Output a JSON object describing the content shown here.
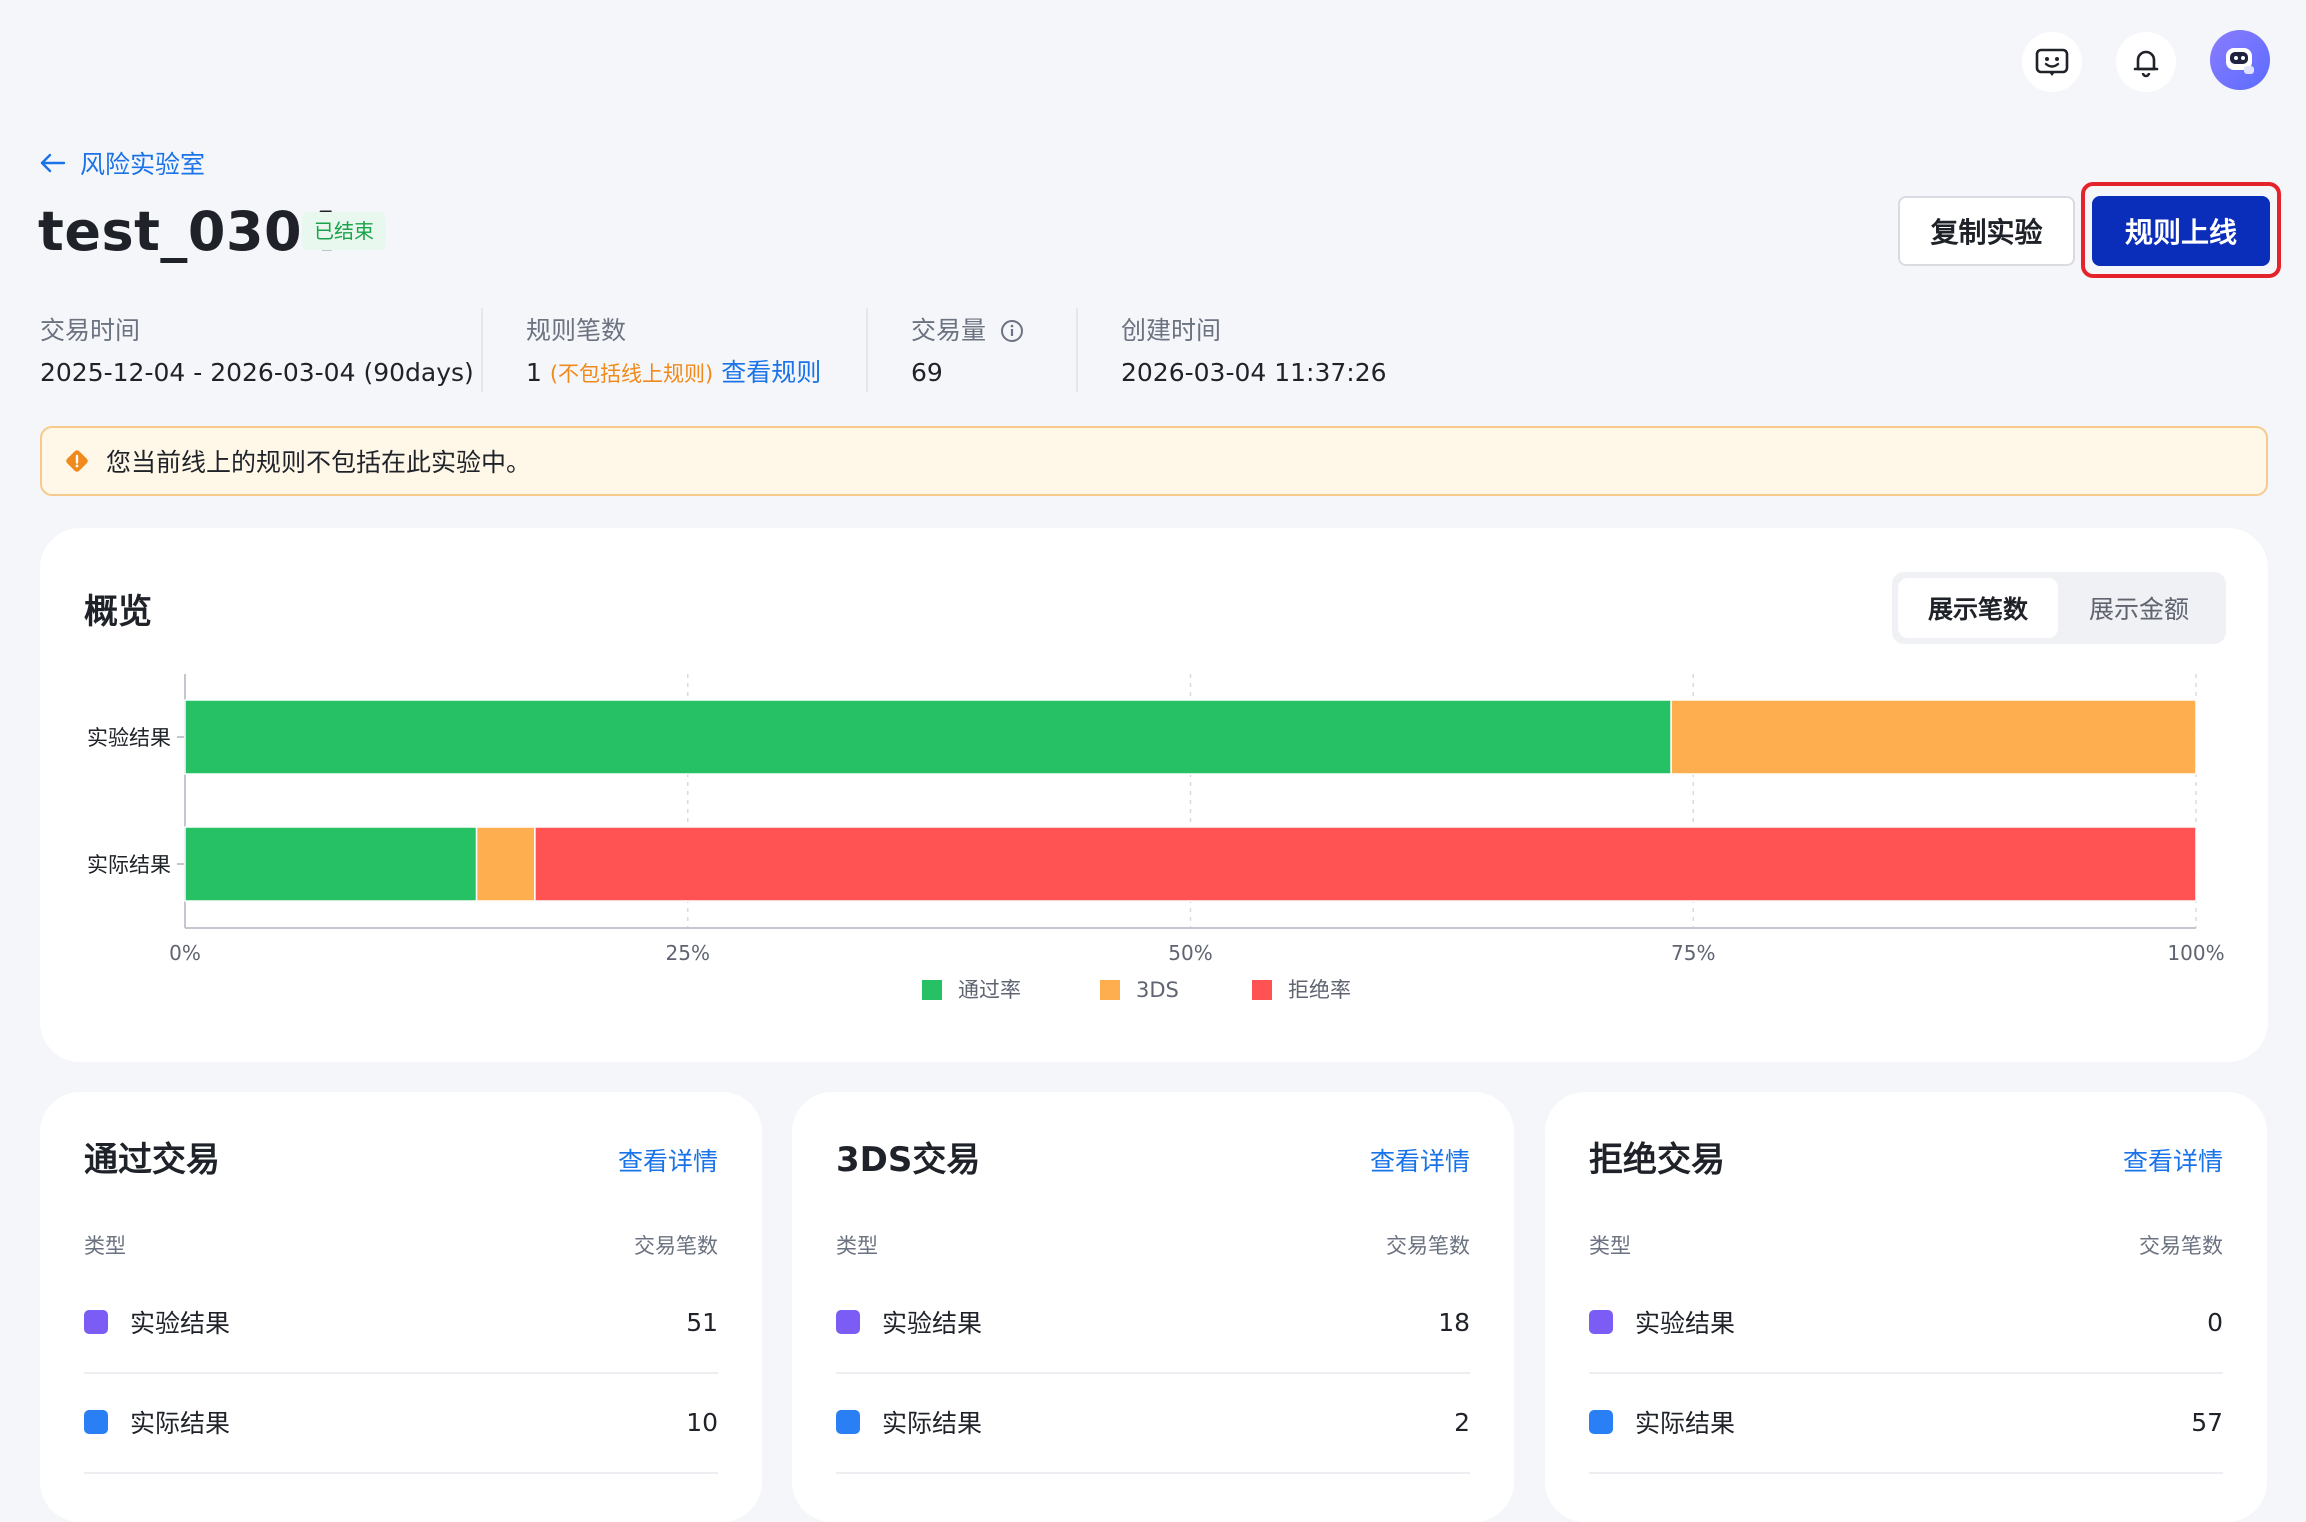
{
  "header": {
    "icons": [
      "chat-bot-icon",
      "bell-icon",
      "avatar"
    ]
  },
  "breadcrumb": {
    "back_label": "风险实验室"
  },
  "experiment": {
    "title": "test_0304",
    "status": "已结束",
    "actions": {
      "copy_label": "复制实验",
      "online_label": "规则上线"
    }
  },
  "meta": {
    "trade_time_label": "交易时间",
    "trade_time_value": "2025-12-04 - 2026-03-04 (90days)",
    "rule_count_label": "规则笔数",
    "rule_count_value": "1",
    "rule_count_note": "(不包括线上规则)",
    "view_rules_link": "查看规则",
    "volume_label": "交易量",
    "volume_value": "69",
    "created_label": "创建时间",
    "created_value": "2026-03-04 11:37:26"
  },
  "warning": {
    "text": "您当前线上的规则不包括在此实验中。"
  },
  "overview": {
    "title": "概览",
    "toggle": {
      "count_label": "展示笔数",
      "amount_label": "展示金额",
      "selected": "展示笔数"
    }
  },
  "chart_data": {
    "type": "bar",
    "orientation": "horizontal",
    "stacked": true,
    "categories": [
      "实验结果",
      "实际结果"
    ],
    "series": [
      {
        "name": "通过率",
        "color": "#26c164",
        "values": [
          73.9,
          14.5
        ]
      },
      {
        "name": "3DS",
        "color": "#ffae4f",
        "values": [
          26.1,
          2.9
        ]
      },
      {
        "name": "拒绝率",
        "color": "#ff5353",
        "values": [
          0,
          82.6
        ]
      }
    ],
    "xticks": [
      "0%",
      "25%",
      "50%",
      "75%",
      "100%"
    ],
    "xlim": [
      0,
      100
    ],
    "grid": true,
    "legend": "bottom"
  },
  "cards": [
    {
      "title": "通过交易",
      "link": "查看详情",
      "col_type": "类型",
      "col_count": "交易笔数",
      "rows": [
        {
          "label": "实验结果",
          "value": "51",
          "color": "#7b5cf5"
        },
        {
          "label": "实际结果",
          "value": "10",
          "color": "#2b7ff5"
        }
      ]
    },
    {
      "title": "3DS交易",
      "link": "查看详情",
      "col_type": "类型",
      "col_count": "交易笔数",
      "rows": [
        {
          "label": "实验结果",
          "value": "18",
          "color": "#7b5cf5"
        },
        {
          "label": "实际结果",
          "value": "2",
          "color": "#2b7ff5"
        }
      ]
    },
    {
      "title": "拒绝交易",
      "link": "查看详情",
      "col_type": "类型",
      "col_count": "交易笔数",
      "rows": [
        {
          "label": "实验结果",
          "value": "0",
          "color": "#7b5cf5"
        },
        {
          "label": "实际结果",
          "value": "57",
          "color": "#2b7ff5"
        }
      ]
    }
  ]
}
